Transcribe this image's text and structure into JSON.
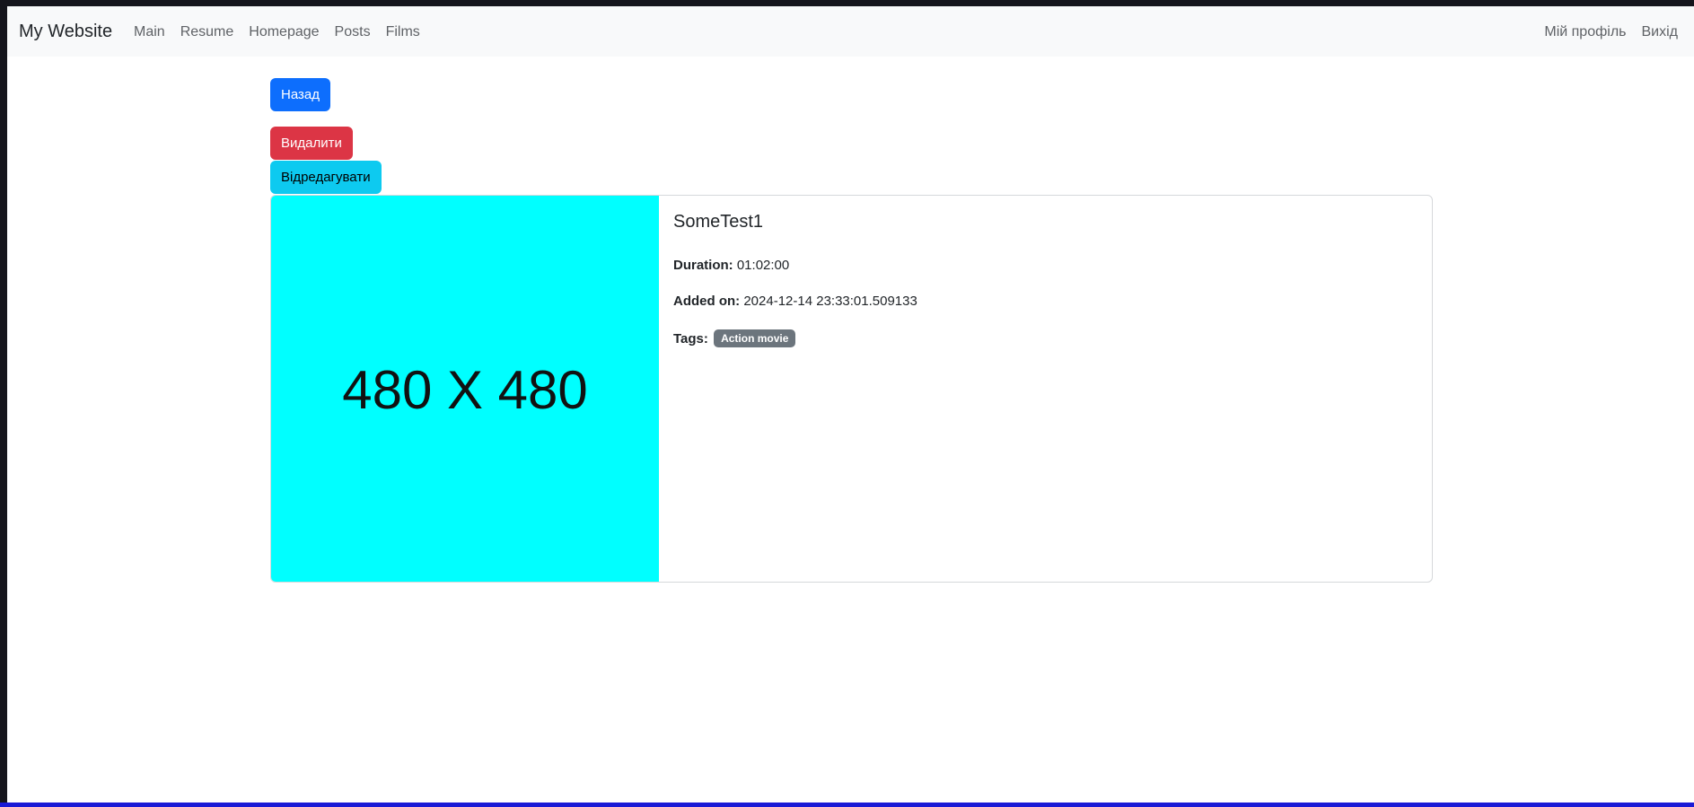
{
  "navbar": {
    "brand": "My Website",
    "links": [
      "Main",
      "Resume",
      "Homepage",
      "Posts",
      "Films"
    ],
    "right_links": [
      "Мій профіль",
      "Вихід"
    ]
  },
  "actions": {
    "back_label": "Назад",
    "delete_label": "Видалити",
    "edit_label": "Відредагувати"
  },
  "film": {
    "poster_placeholder": "480 X 480",
    "title": "SomeTest1",
    "duration_label": "Duration:",
    "duration": "01:02:00",
    "added_label": "Added on:",
    "added_on": "2024-12-14 23:33:01.509133",
    "tags_label": "Tags:",
    "tags": [
      "Action movie"
    ]
  },
  "colors": {
    "primary": "#0d6efd",
    "danger": "#dc3545",
    "info": "#0dcaf0",
    "secondary": "#6c757d",
    "poster_bg": "#00ffff"
  }
}
